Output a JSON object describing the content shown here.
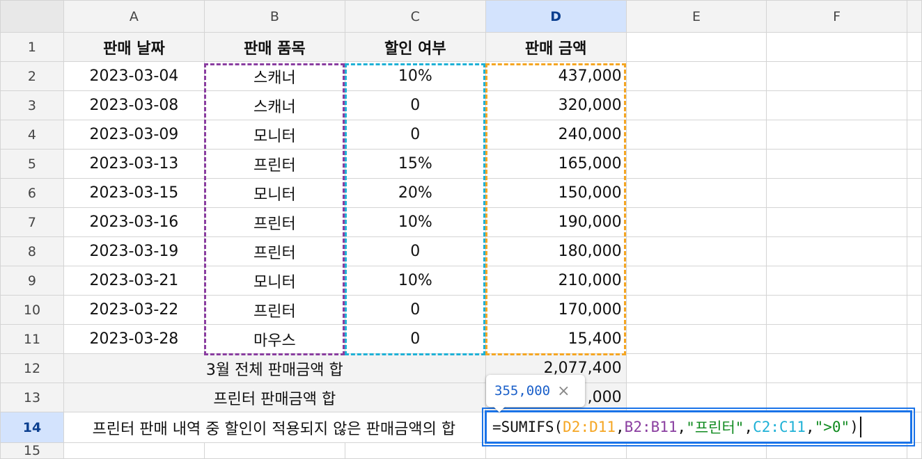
{
  "columns": [
    "A",
    "B",
    "C",
    "D",
    "E",
    "F"
  ],
  "selected_column": "D",
  "headers": [
    "판매 날짜",
    "판매 품목",
    "할인 여부",
    "판매 금액"
  ],
  "rows": [
    [
      "2023-03-04",
      "스캐너",
      "10%",
      "437,000"
    ],
    [
      "2023-03-08",
      "스캐너",
      "0",
      "320,000"
    ],
    [
      "2023-03-09",
      "모니터",
      "0",
      "240,000"
    ],
    [
      "2023-03-13",
      "프린터",
      "15%",
      "165,000"
    ],
    [
      "2023-03-15",
      "모니터",
      "20%",
      "150,000"
    ],
    [
      "2023-03-16",
      "프린터",
      "10%",
      "190,000"
    ],
    [
      "2023-03-19",
      "프린터",
      "0",
      "180,000"
    ],
    [
      "2023-03-21",
      "모니터",
      "10%",
      "210,000"
    ],
    [
      "2023-03-22",
      "프린터",
      "0",
      "170,000"
    ],
    [
      "2023-03-28",
      "마우스",
      "0",
      "15,400"
    ]
  ],
  "row_numbers": [
    "1",
    "2",
    "3",
    "4",
    "5",
    "6",
    "7",
    "8",
    "9",
    "10",
    "11",
    "12",
    "13",
    "14",
    "15"
  ],
  "summary": [
    {
      "label": "3월 전체 판매금액 합",
      "value": "2,077,400"
    },
    {
      "label": "프린터 판매금액 합",
      "value": ",000"
    },
    {
      "label": "프린터 판매 내역 중 할인이 적용되지 않은 판매금액의 합",
      "value": ""
    }
  ],
  "formula": {
    "parts": [
      {
        "text": "=SUMIFS(",
        "color": "#111111"
      },
      {
        "text": "D2:D11",
        "color": "#f5a623"
      },
      {
        "text": ",",
        "color": "#111111"
      },
      {
        "text": "B2:B11",
        "color": "#8a3ea0"
      },
      {
        "text": ",",
        "color": "#111111"
      },
      {
        "text": "\"프린터\"",
        "color": "#0f8a1f"
      },
      {
        "text": ",",
        "color": "#111111"
      },
      {
        "text": "C2:C11",
        "color": "#1fb1d6"
      },
      {
        "text": ",",
        "color": "#111111"
      },
      {
        "text": "\">0\"",
        "color": "#0f8a1f"
      },
      {
        "text": ")",
        "color": "#111111"
      }
    ]
  },
  "tooltip": {
    "value": "355,000",
    "close_glyph": "×"
  },
  "icons": {
    "tooltip_close": "close-icon"
  }
}
